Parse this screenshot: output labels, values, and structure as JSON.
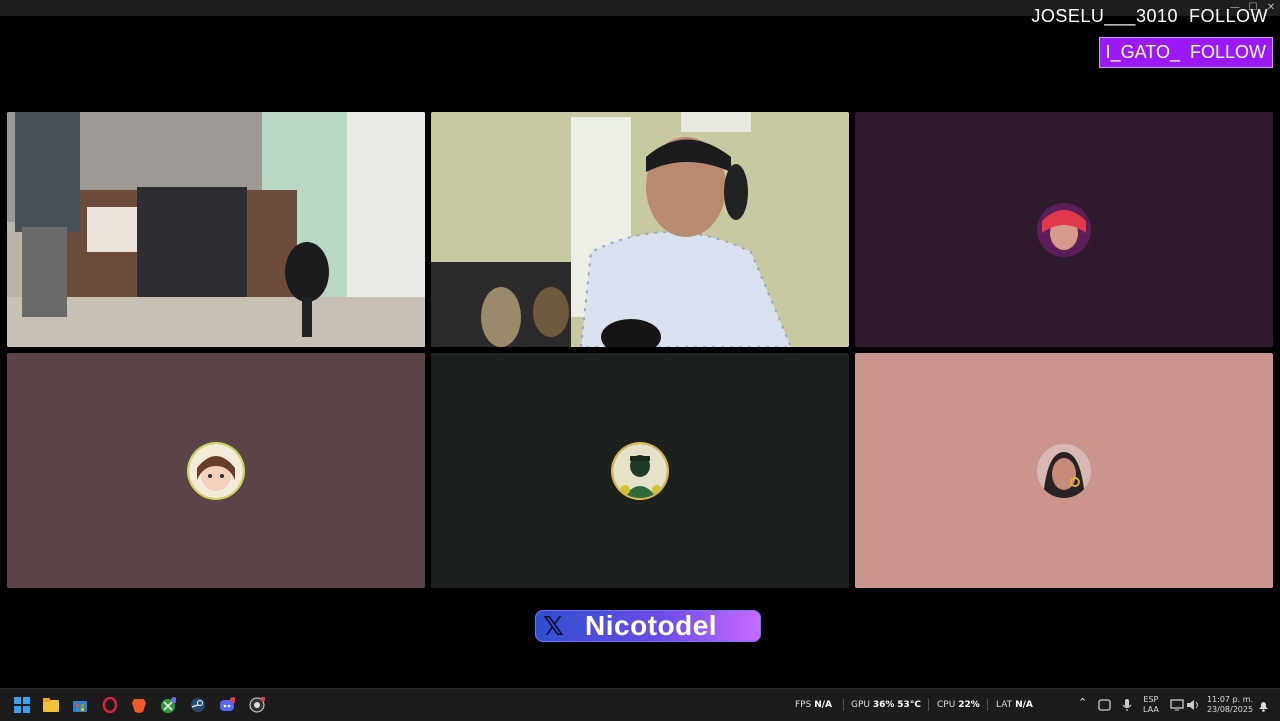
{
  "overlay": {
    "follow_line1": "JOSELU___3010  FOLLOW",
    "follow_line2": "I_GATO_  FOLLOW"
  },
  "tiles": [
    {
      "name": "camera-tile-room",
      "type": "video",
      "color": "#b9b3a8"
    },
    {
      "name": "camera-tile-streamer",
      "type": "video",
      "color": "#c8c9a0"
    },
    {
      "name": "avatar-tile-1",
      "type": "avatar",
      "color": "#2e1a2c"
    },
    {
      "name": "avatar-tile-2",
      "type": "avatar",
      "color": "#5b4447"
    },
    {
      "name": "avatar-tile-3",
      "type": "avatar",
      "color": "#1d211d"
    },
    {
      "name": "avatar-tile-4",
      "type": "avatar",
      "color": "#c9958c"
    }
  ],
  "banner": {
    "icon": "x-logo-icon",
    "name": "Nicotodel"
  },
  "taskbar": {
    "apps": [
      "windows-start-icon",
      "file-explorer-icon",
      "microsoft-store-icon",
      "opera-gx-icon",
      "brave-icon",
      "xbox-icon",
      "steam-icon",
      "discord-icon",
      "obs-icon"
    ],
    "fps_label": "FPS",
    "fps_value": "N/A",
    "gpu_label": "GPU",
    "gpu_value": "36%",
    "gpu_temp": "53°C",
    "cpu_label": "CPU",
    "cpu_value": "22%",
    "lat_label": "LAT",
    "lat_value": "N/A",
    "lang_line1": "ESP",
    "lang_line2": "LAA",
    "time": "11:07 p. m.",
    "date": "23/08/2025"
  }
}
